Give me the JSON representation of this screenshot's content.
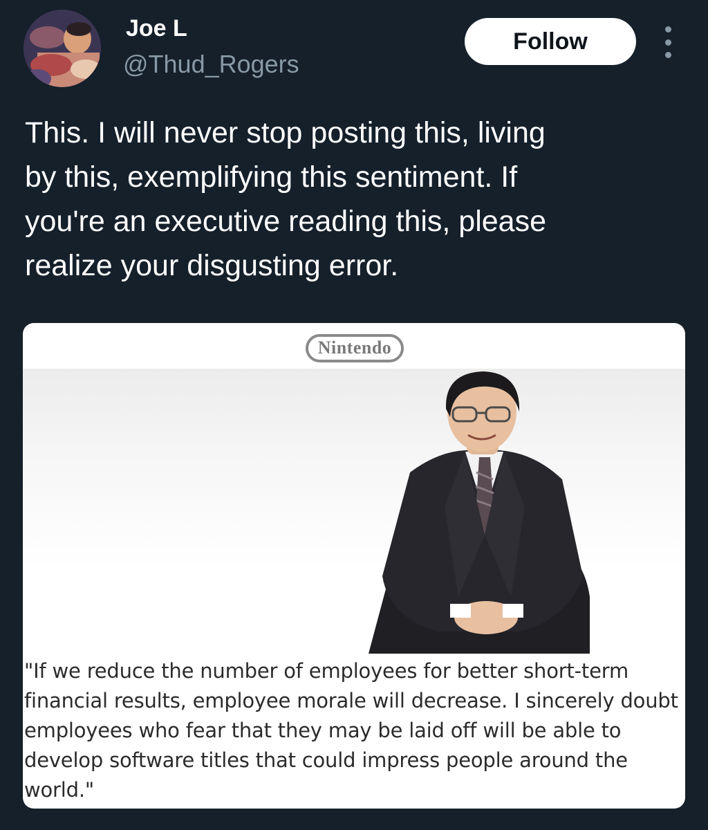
{
  "header": {
    "display_name": "Joe L",
    "handle": "@Thud_Rogers",
    "follow_label": "Follow",
    "more_icon": "more-vertical-icon"
  },
  "tweet": {
    "text": "This. I will never stop posting this, living\nby this, exemplifying this sentiment. If\nyou're an executive reading this, please\nrealize your disgusting error."
  },
  "media": {
    "logo_text": "Nintendo",
    "quote": "\"If we reduce the number of employees for better short-term financial results, employee morale will decrease. I sincerely doubt employees who fear that they may be laid off will be able to develop software titles that could impress people around the world.\""
  },
  "colors": {
    "background": "#15202b",
    "secondary_text": "#8899a6",
    "follow_button_bg": "#ffffff"
  }
}
